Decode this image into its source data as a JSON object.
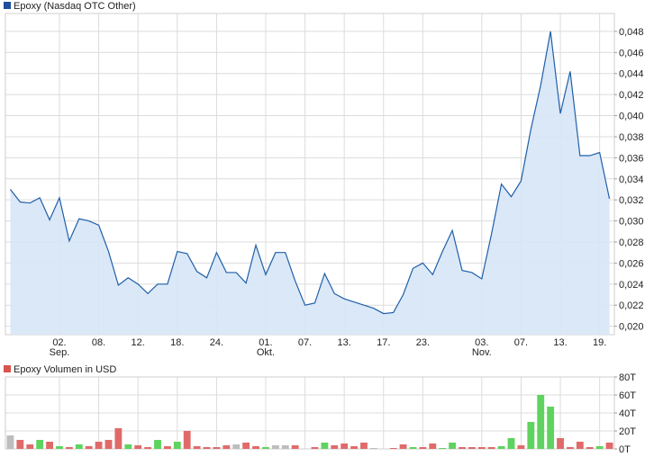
{
  "colors": {
    "price_line": "#1f5fa8",
    "price_fill": "#d7e5f7",
    "grid": "#dcdcdc",
    "volume_up": "#5fd35f",
    "volume_down": "#e06a6a",
    "volume_neutral": "#bdbdbd",
    "legend_price": "#1f4e9c",
    "legend_volume": "#d9534f"
  },
  "chart_data": [
    {
      "type": "area",
      "title": "Epoxy (Nasdaq OTC Other)",
      "legend": [
        "Epoxy (Nasdaq OTC Other)"
      ],
      "legend_position": "top-left",
      "grid": true,
      "y_axis_side": "right",
      "ylim": [
        0.0192,
        0.0497
      ],
      "y_ticks": [
        "0,020",
        "0,022",
        "0,024",
        "0,026",
        "0,028",
        "0,030",
        "0,032",
        "0,034",
        "0,036",
        "0,038",
        "0,040",
        "0,042",
        "0,044",
        "0,046",
        "0,048"
      ],
      "y_tick_values": [
        0.02,
        0.022,
        0.024,
        0.026,
        0.028,
        0.03,
        0.032,
        0.034,
        0.036,
        0.038,
        0.04,
        0.042,
        0.044,
        0.046,
        0.048
      ],
      "x_ticks": [
        {
          "i": 5,
          "label": "02.",
          "sub": "Sep."
        },
        {
          "i": 9,
          "label": "08.",
          "sub": ""
        },
        {
          "i": 13,
          "label": "12.",
          "sub": ""
        },
        {
          "i": 17,
          "label": "18.",
          "sub": ""
        },
        {
          "i": 21,
          "label": "24.",
          "sub": ""
        },
        {
          "i": 26,
          "label": "01.",
          "sub": "Okt."
        },
        {
          "i": 30,
          "label": "07.",
          "sub": ""
        },
        {
          "i": 34,
          "label": "13.",
          "sub": ""
        },
        {
          "i": 38,
          "label": "17.",
          "sub": ""
        },
        {
          "i": 42,
          "label": "23.",
          "sub": ""
        },
        {
          "i": 48,
          "label": "03.",
          "sub": "Nov."
        },
        {
          "i": 52,
          "label": "07.",
          "sub": ""
        },
        {
          "i": 56,
          "label": "13.",
          "sub": ""
        },
        {
          "i": 60,
          "label": "19.",
          "sub": ""
        }
      ],
      "values": [
        0.033,
        0.0318,
        0.0317,
        0.0322,
        0.0301,
        0.0322,
        0.0281,
        0.0302,
        0.03,
        0.0296,
        0.0271,
        0.0239,
        0.0246,
        0.024,
        0.0231,
        0.024,
        0.024,
        0.0271,
        0.0269,
        0.0252,
        0.0246,
        0.027,
        0.0251,
        0.0251,
        0.0241,
        0.0277,
        0.0249,
        0.027,
        0.027,
        0.0243,
        0.022,
        0.0222,
        0.025,
        0.0231,
        0.0226,
        0.0223,
        0.022,
        0.0217,
        0.0212,
        0.0213,
        0.023,
        0.0255,
        0.026,
        0.0249,
        0.0271,
        0.0291,
        0.0253,
        0.0251,
        0.0245,
        0.0288,
        0.0335,
        0.0323,
        0.0338,
        0.0387,
        0.0429,
        0.048,
        0.0402,
        0.0442,
        0.0362,
        0.0362,
        0.0365,
        0.0321
      ]
    },
    {
      "type": "bar",
      "title": "Epoxy Volumen in USD",
      "legend": [
        "Epoxy Volumen in USD"
      ],
      "legend_position": "top-left",
      "grid": true,
      "y_axis_side": "right",
      "ylim": [
        0,
        80
      ],
      "y_ticks": [
        "0T",
        "20T",
        "40T",
        "60T",
        "80T"
      ],
      "y_tick_values": [
        0,
        20,
        40,
        60,
        80
      ],
      "values": [
        15,
        10,
        5,
        10,
        8,
        3,
        2,
        5,
        3,
        8,
        10,
        23,
        5,
        4,
        2,
        10,
        3,
        8,
        20,
        3,
        2,
        2,
        4,
        5,
        7,
        3,
        2,
        4,
        4,
        4,
        0,
        2,
        7,
        4,
        6,
        3,
        7,
        1,
        0,
        1,
        5,
        2,
        2,
        6,
        1,
        7,
        2,
        2,
        2,
        2,
        3,
        12,
        4,
        30,
        60,
        47,
        12,
        2,
        8,
        2,
        3,
        7
      ],
      "directions": [
        "n",
        "d",
        "d",
        "u",
        "d",
        "u",
        "d",
        "u",
        "d",
        "d",
        "d",
        "d",
        "u",
        "d",
        "d",
        "u",
        "d",
        "u",
        "d",
        "d",
        "d",
        "d",
        "d",
        "n",
        "d",
        "d",
        "u",
        "n",
        "n",
        "d",
        "n",
        "d",
        "u",
        "d",
        "d",
        "d",
        "d",
        "n",
        "n",
        "d",
        "d",
        "u",
        "d",
        "d",
        "u",
        "u",
        "d",
        "d",
        "d",
        "d",
        "u",
        "u",
        "d",
        "u",
        "u",
        "u",
        "d",
        "d",
        "d",
        "d",
        "u",
        "d"
      ]
    }
  ]
}
